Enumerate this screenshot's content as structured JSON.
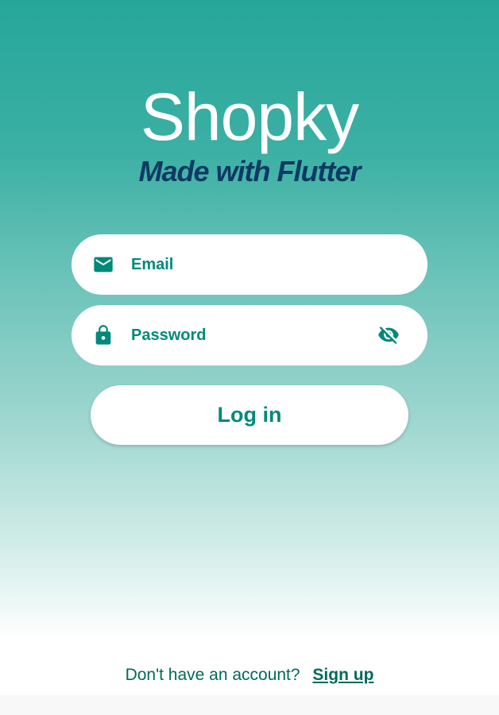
{
  "app": {
    "title": "Shopky",
    "subtitle": "Made with Flutter"
  },
  "form": {
    "email": {
      "placeholder": "Email",
      "value": "",
      "icon": "email-icon"
    },
    "password": {
      "placeholder": "Password",
      "value": "",
      "icon": "lock-icon",
      "toggle_icon": "visibility-off-icon"
    },
    "login_label": "Log in"
  },
  "footer": {
    "prompt": "Don't have an account?",
    "signup_label": "Sign up"
  },
  "colors": {
    "accent": "#00897b",
    "brand_dark": "#0d3a63",
    "gradient_top": "#26a69a"
  }
}
